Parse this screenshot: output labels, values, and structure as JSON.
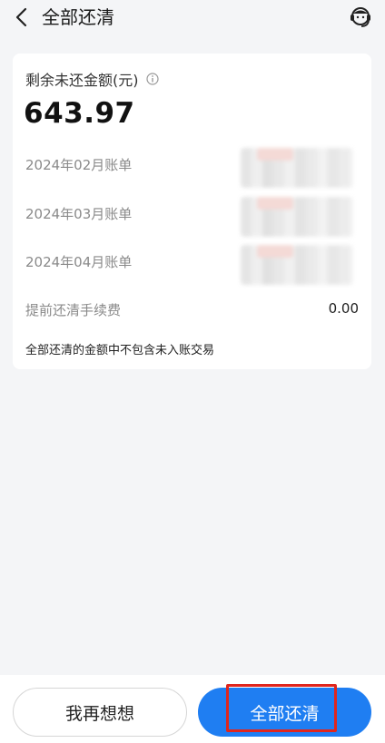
{
  "header": {
    "title": "全部还清",
    "back_icon": "chevron-left-icon",
    "service_icon": "customer-service-icon"
  },
  "card": {
    "balance_label": "剩余未还金额(元)",
    "balance_amount": "643.97",
    "bills": [
      {
        "label": "2024年02月账单"
      },
      {
        "label": "2024年03月账单"
      },
      {
        "label": "2024年04月账单"
      }
    ],
    "fee_label": "提前还清手续费",
    "fee_value": "0.00",
    "note": "全部还清的金额中不包含未入账交易"
  },
  "footer": {
    "cancel_label": "我再想想",
    "confirm_label": "全部还清"
  },
  "colors": {
    "primary": "#1f7ef2",
    "highlight": "#e0261d"
  }
}
